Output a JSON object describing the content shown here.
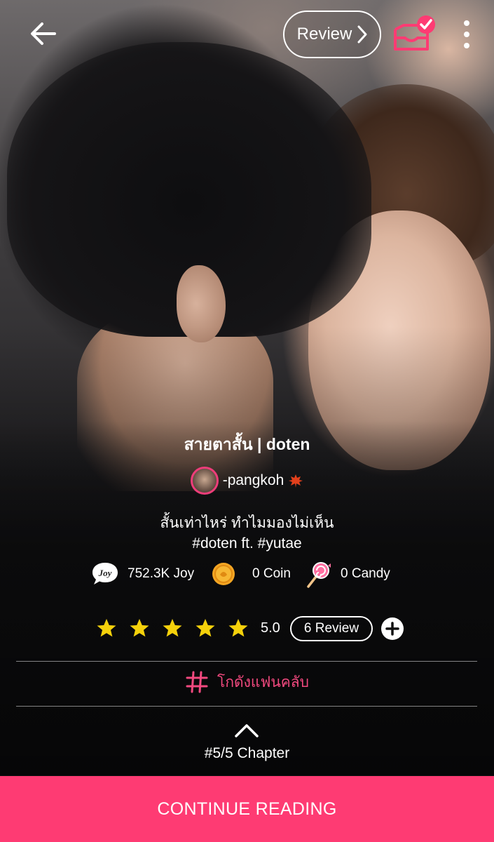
{
  "header": {
    "review_label": "Review"
  },
  "story": {
    "title": "สายตาสั้น | doten",
    "author": "-pangkoh",
    "description_line1": "สั้นเท่าไหร่ ทำไมมองไม่เห็น",
    "description_line2": "#doten ft. #yutae"
  },
  "stats": {
    "joy": "752.3K Joy",
    "coin": "0 Coin",
    "candy": "0 Candy"
  },
  "rating": {
    "value": "5.0",
    "stars": 5,
    "reviews_label": "6 Review"
  },
  "fanclub_label": "โกดังแฟนคลับ",
  "chapter_label": "#5/5 Chapter",
  "continue_label": "CONTINUE READING",
  "colors": {
    "accent": "#fe3b73",
    "fanclub": "#f2497f",
    "star": "#f5d10b"
  },
  "icons": [
    "back-arrow-icon",
    "chevron-right-icon",
    "library-check-icon",
    "more-vert-icon",
    "leaf-icon",
    "joy-icon",
    "coin-icon",
    "candy-icon",
    "star-icon",
    "plus-circle-icon",
    "hashtag-icon",
    "chevron-up-icon"
  ]
}
